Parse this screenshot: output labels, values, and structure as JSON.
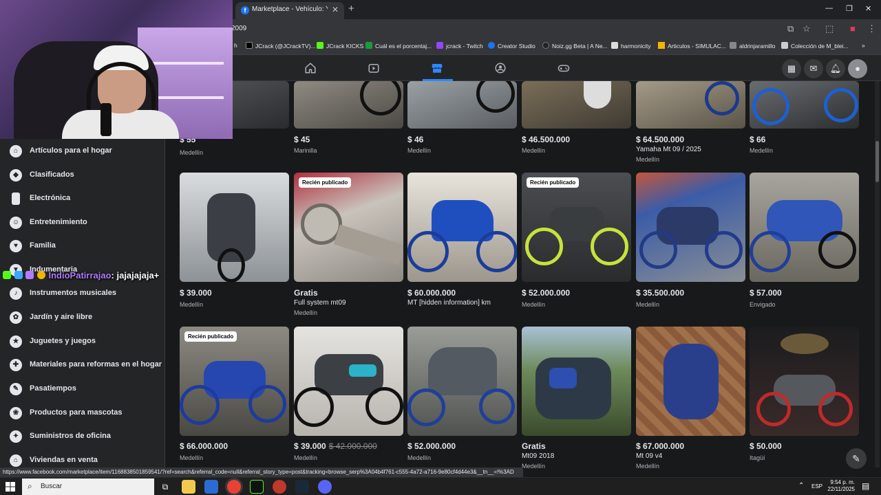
{
  "browser": {
    "tab_title": "Marketplace - Vehículo: Ya",
    "url": "2009",
    "bookmarks": [
      {
        "label": "h",
        "color": "#555555"
      },
      {
        "label": "JCrack (@JCrackTV)...",
        "color": "#000000"
      },
      {
        "label": "JCrack KICKS",
        "color": "#53fc18"
      },
      {
        "label": "Cuál es el porcentaj...",
        "color": "#1a9c3a"
      },
      {
        "label": "jcrack - Twitch",
        "color": "#9146ff"
      },
      {
        "label": "Creator Studio",
        "color": "#1877f2"
      },
      {
        "label": "Noiz.gg Beta | A Ne...",
        "color": "#222222"
      },
      {
        "label": "harmonicity",
        "color": "#dddddd"
      },
      {
        "label": "Articulos - SIMULAC...",
        "color": "#f4b400"
      },
      {
        "label": "aldrinjaramillo",
        "color": "#888888"
      },
      {
        "label": "Colección de M_blei...",
        "color": "#cccccc"
      }
    ]
  },
  "sidebar": {
    "items": [
      {
        "label": "Artículos para el hogar",
        "icon": "home-goods-icon"
      },
      {
        "label": "Clasificados",
        "icon": "tag-icon"
      },
      {
        "label": "Electrónica",
        "icon": "phone-icon"
      },
      {
        "label": "Entretenimiento",
        "icon": "people-icon"
      },
      {
        "label": "Familia",
        "icon": "heart-icon"
      },
      {
        "label": "Indumentaria",
        "icon": "shirt-icon"
      },
      {
        "label": "Instrumentos musicales",
        "icon": "guitar-icon"
      },
      {
        "label": "Jardín y aire libre",
        "icon": "plant-icon"
      },
      {
        "label": "Juguetes y juegos",
        "icon": "toy-icon"
      },
      {
        "label": "Materiales para reformas en el hogar",
        "icon": "tools-icon"
      },
      {
        "label": "Pasatiempos",
        "icon": "brush-icon"
      },
      {
        "label": "Productos para mascotas",
        "icon": "paw-icon"
      },
      {
        "label": "Suministros de oficina",
        "icon": "office-icon"
      },
      {
        "label": "Viviendas en venta",
        "icon": "house-icon"
      }
    ]
  },
  "chat": {
    "username": "IndioPatirrajao",
    "message": ": jajajajaja+"
  },
  "listings_row1": [
    {
      "price": "$ 55",
      "title": "",
      "location": "Medellín"
    },
    {
      "price": "$ 45",
      "title": "",
      "location": "Marinilla"
    },
    {
      "price": "$ 46",
      "title": "",
      "location": "Medellín"
    },
    {
      "price": "$ 46.500.000",
      "title": "",
      "location": "Medellín"
    },
    {
      "price": "$ 64.500.000",
      "title": "Yamaha Mt 09 / 2025",
      "location": "Medellín"
    },
    {
      "price": "$ 66",
      "title": "",
      "location": "Medellín"
    }
  ],
  "listings_row2": [
    {
      "price": "$ 39.000",
      "title": "",
      "location": "Medellín",
      "badge": ""
    },
    {
      "price": "Gratis",
      "title": "Full system mt09",
      "location": "Medellín",
      "badge": "Recién publicado"
    },
    {
      "price": "$ 60.000.000",
      "title": "MT [hidden information] km",
      "location": "Medellín",
      "badge": ""
    },
    {
      "price": "$ 52.000.000",
      "title": "",
      "location": "Medellín",
      "badge": "Recién publicado"
    },
    {
      "price": "$ 35.500.000",
      "title": "",
      "location": "Medellín",
      "badge": ""
    },
    {
      "price": "$ 57.000",
      "title": "",
      "location": "Envigado",
      "badge": ""
    }
  ],
  "listings_row3": [
    {
      "price": "$ 66.000.000",
      "old_price": "",
      "title": "",
      "location": "Medellín",
      "badge": "Recién publicado"
    },
    {
      "price": "$ 39.000",
      "old_price": "$ 42.000.000",
      "title": "",
      "location": "Medellín",
      "badge": ""
    },
    {
      "price": "$ 52.000.000",
      "old_price": "",
      "title": "",
      "location": "Medellín",
      "badge": ""
    },
    {
      "price": "Gratis",
      "old_price": "",
      "title": "Mt09 2018",
      "location": "Medellín",
      "badge": ""
    },
    {
      "price": "$ 67.000.000",
      "old_price": "",
      "title": "Mt 09 v4",
      "location": "Medellín",
      "badge": ""
    },
    {
      "price": "$ 50.000",
      "old_price": "",
      "title": "",
      "location": "Itagüí",
      "badge": ""
    }
  ],
  "status_url": "https://www.facebook.com/marketplace/item/1168838501859541/?ref=search&referral_code=null&referral_story_type=post&tracking=browse_serp%3A04b4f761-c555-4a72-a716-9e80cf4d44e3&__tn__=!%3AD",
  "taskbar": {
    "search_placeholder": "Buscar",
    "language": "ESP",
    "time": "9:54 p. m.",
    "date": "22/11/2025"
  },
  "colors": {
    "accent": "#2d88ff",
    "background": "#18191a",
    "surface": "#242526"
  }
}
